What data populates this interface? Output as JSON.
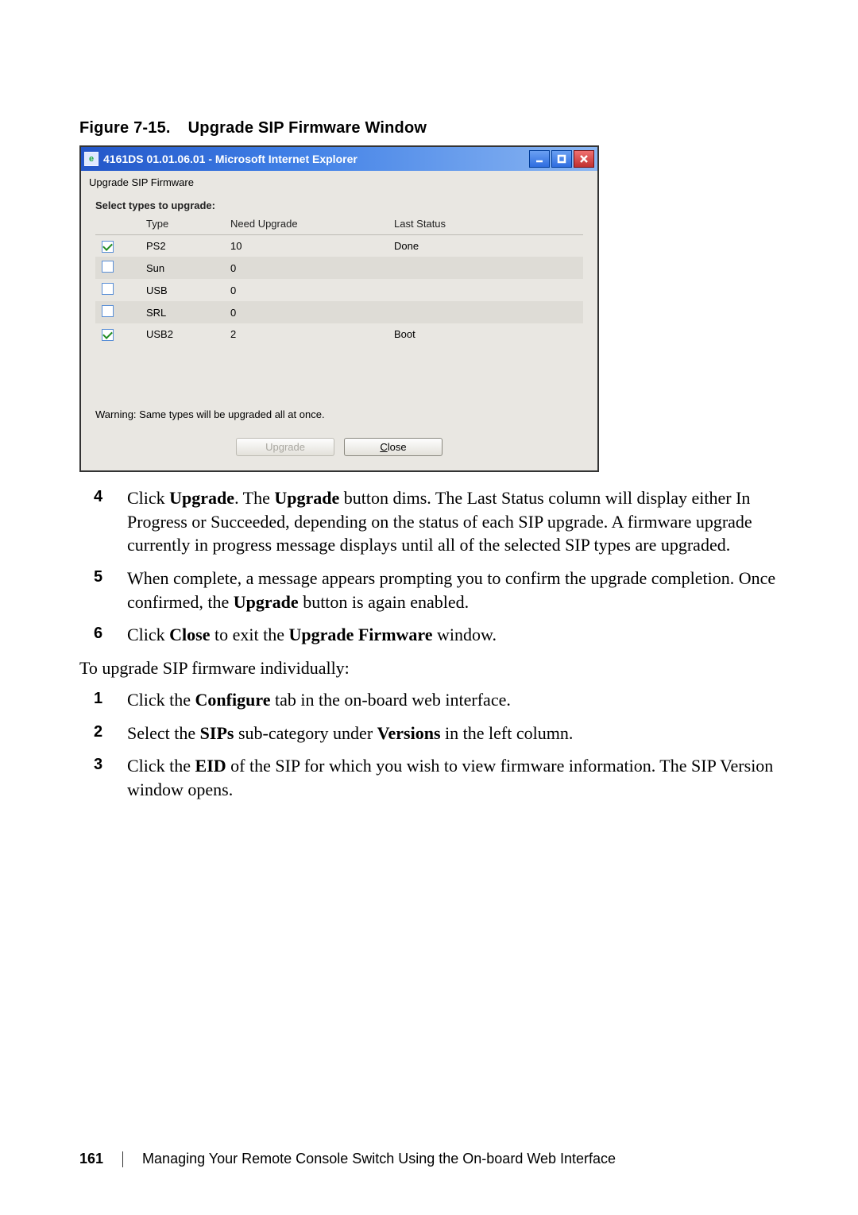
{
  "figure_caption_prefix": "Figure 7-15.",
  "figure_caption_title": "Upgrade SIP Firmware Window",
  "window": {
    "title": "4161DS 01.01.06.01 - Microsoft Internet Explorer",
    "controls": {
      "minimize_tooltip": "Minimize",
      "maximize_tooltip": "Maximize",
      "close_tooltip": "Close"
    },
    "subtitle": "Upgrade SIP Firmware",
    "select_label": "Select types to upgrade:",
    "headers": {
      "col_check": "",
      "col_type": "Type",
      "col_need": "Need Upgrade",
      "col_status": "Last Status"
    },
    "rows": [
      {
        "checked": true,
        "type": "PS2",
        "need": "10",
        "status": "Done"
      },
      {
        "checked": false,
        "type": "Sun",
        "need": "0",
        "status": ""
      },
      {
        "checked": false,
        "type": "USB",
        "need": "0",
        "status": ""
      },
      {
        "checked": false,
        "type": "SRL",
        "need": "0",
        "status": ""
      },
      {
        "checked": true,
        "type": "USB2",
        "need": "2",
        "status": "Boot"
      }
    ],
    "warning": "Warning: Same types will be upgraded all at once.",
    "buttons": {
      "upgrade": "Upgrade",
      "close": "Close"
    }
  },
  "step4_a": "Click ",
  "step4_b": "Upgrade",
  "step4_c": ". The ",
  "step4_d": "Upgrade",
  "step4_e": " button dims. The Last Status column will display either In Progress or Succeeded, depending on the status of each SIP upgrade. A firmware upgrade currently in progress message displays until all of the selected SIP types are upgraded.",
  "step5_a": "When complete, a message appears prompting you to confirm the upgrade completion. Once confirmed, the ",
  "step5_b": "Upgrade",
  "step5_c": " button is again enabled.",
  "step6_a": "Click ",
  "step6_b": "Close",
  "step6_c": " to exit the ",
  "step6_d": "Upgrade Firmware",
  "step6_e": " window.",
  "lead2": "To upgrade SIP firmware individually:",
  "step1b_a": "Click the ",
  "step1b_b": "Configure",
  "step1b_c": " tab in the on-board web interface.",
  "step2b_a": "Select the ",
  "step2b_b": "SIPs",
  "step2b_c": " sub-category under ",
  "step2b_d": "Versions",
  "step2b_e": " in the left column.",
  "step3b_a": "Click the ",
  "step3b_b": "EID",
  "step3b_c": " of the SIP for which you wish to view firmware information. The SIP Version window opens.",
  "numbers": {
    "n4": "4",
    "n5": "5",
    "n6": "6",
    "n1": "1",
    "n2": "2",
    "n3": "3"
  },
  "footer": {
    "page": "161",
    "text": "Managing Your Remote Console Switch Using the On-board Web Interface"
  }
}
